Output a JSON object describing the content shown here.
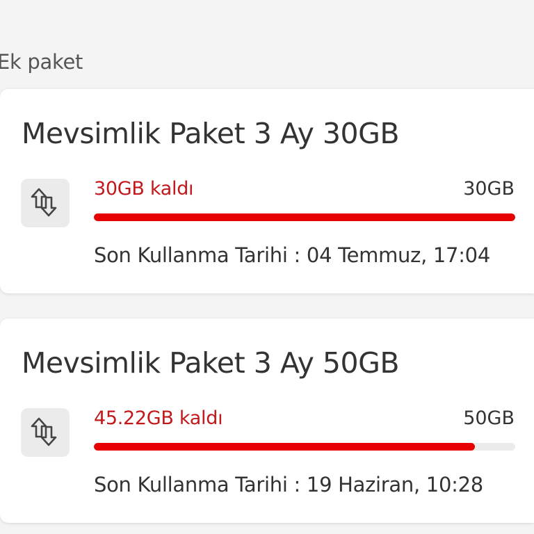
{
  "section": {
    "title": "Ek paket"
  },
  "packages": [
    {
      "name": "Mevsimlik Paket 3 Ay 30GB",
      "remaining_label": "30GB kaldı",
      "total_label": "30GB",
      "remaining_fraction": 1.0,
      "expiry_label": "Son Kullanma Tarihi : 04 Temmuz, 17:04",
      "icon": "data-transfer-icon"
    },
    {
      "name": "Mevsimlik Paket 3 Ay 50GB",
      "remaining_label": "45.22GB kaldı",
      "total_label": "50GB",
      "remaining_fraction": 0.9044,
      "expiry_label": "Son Kullanma Tarihi : 19 Haziran, 10:28",
      "icon": "data-transfer-icon"
    }
  ],
  "colors": {
    "accent_red": "#e60000",
    "remaining_text": "#c2181b",
    "track": "#ebebeb"
  }
}
